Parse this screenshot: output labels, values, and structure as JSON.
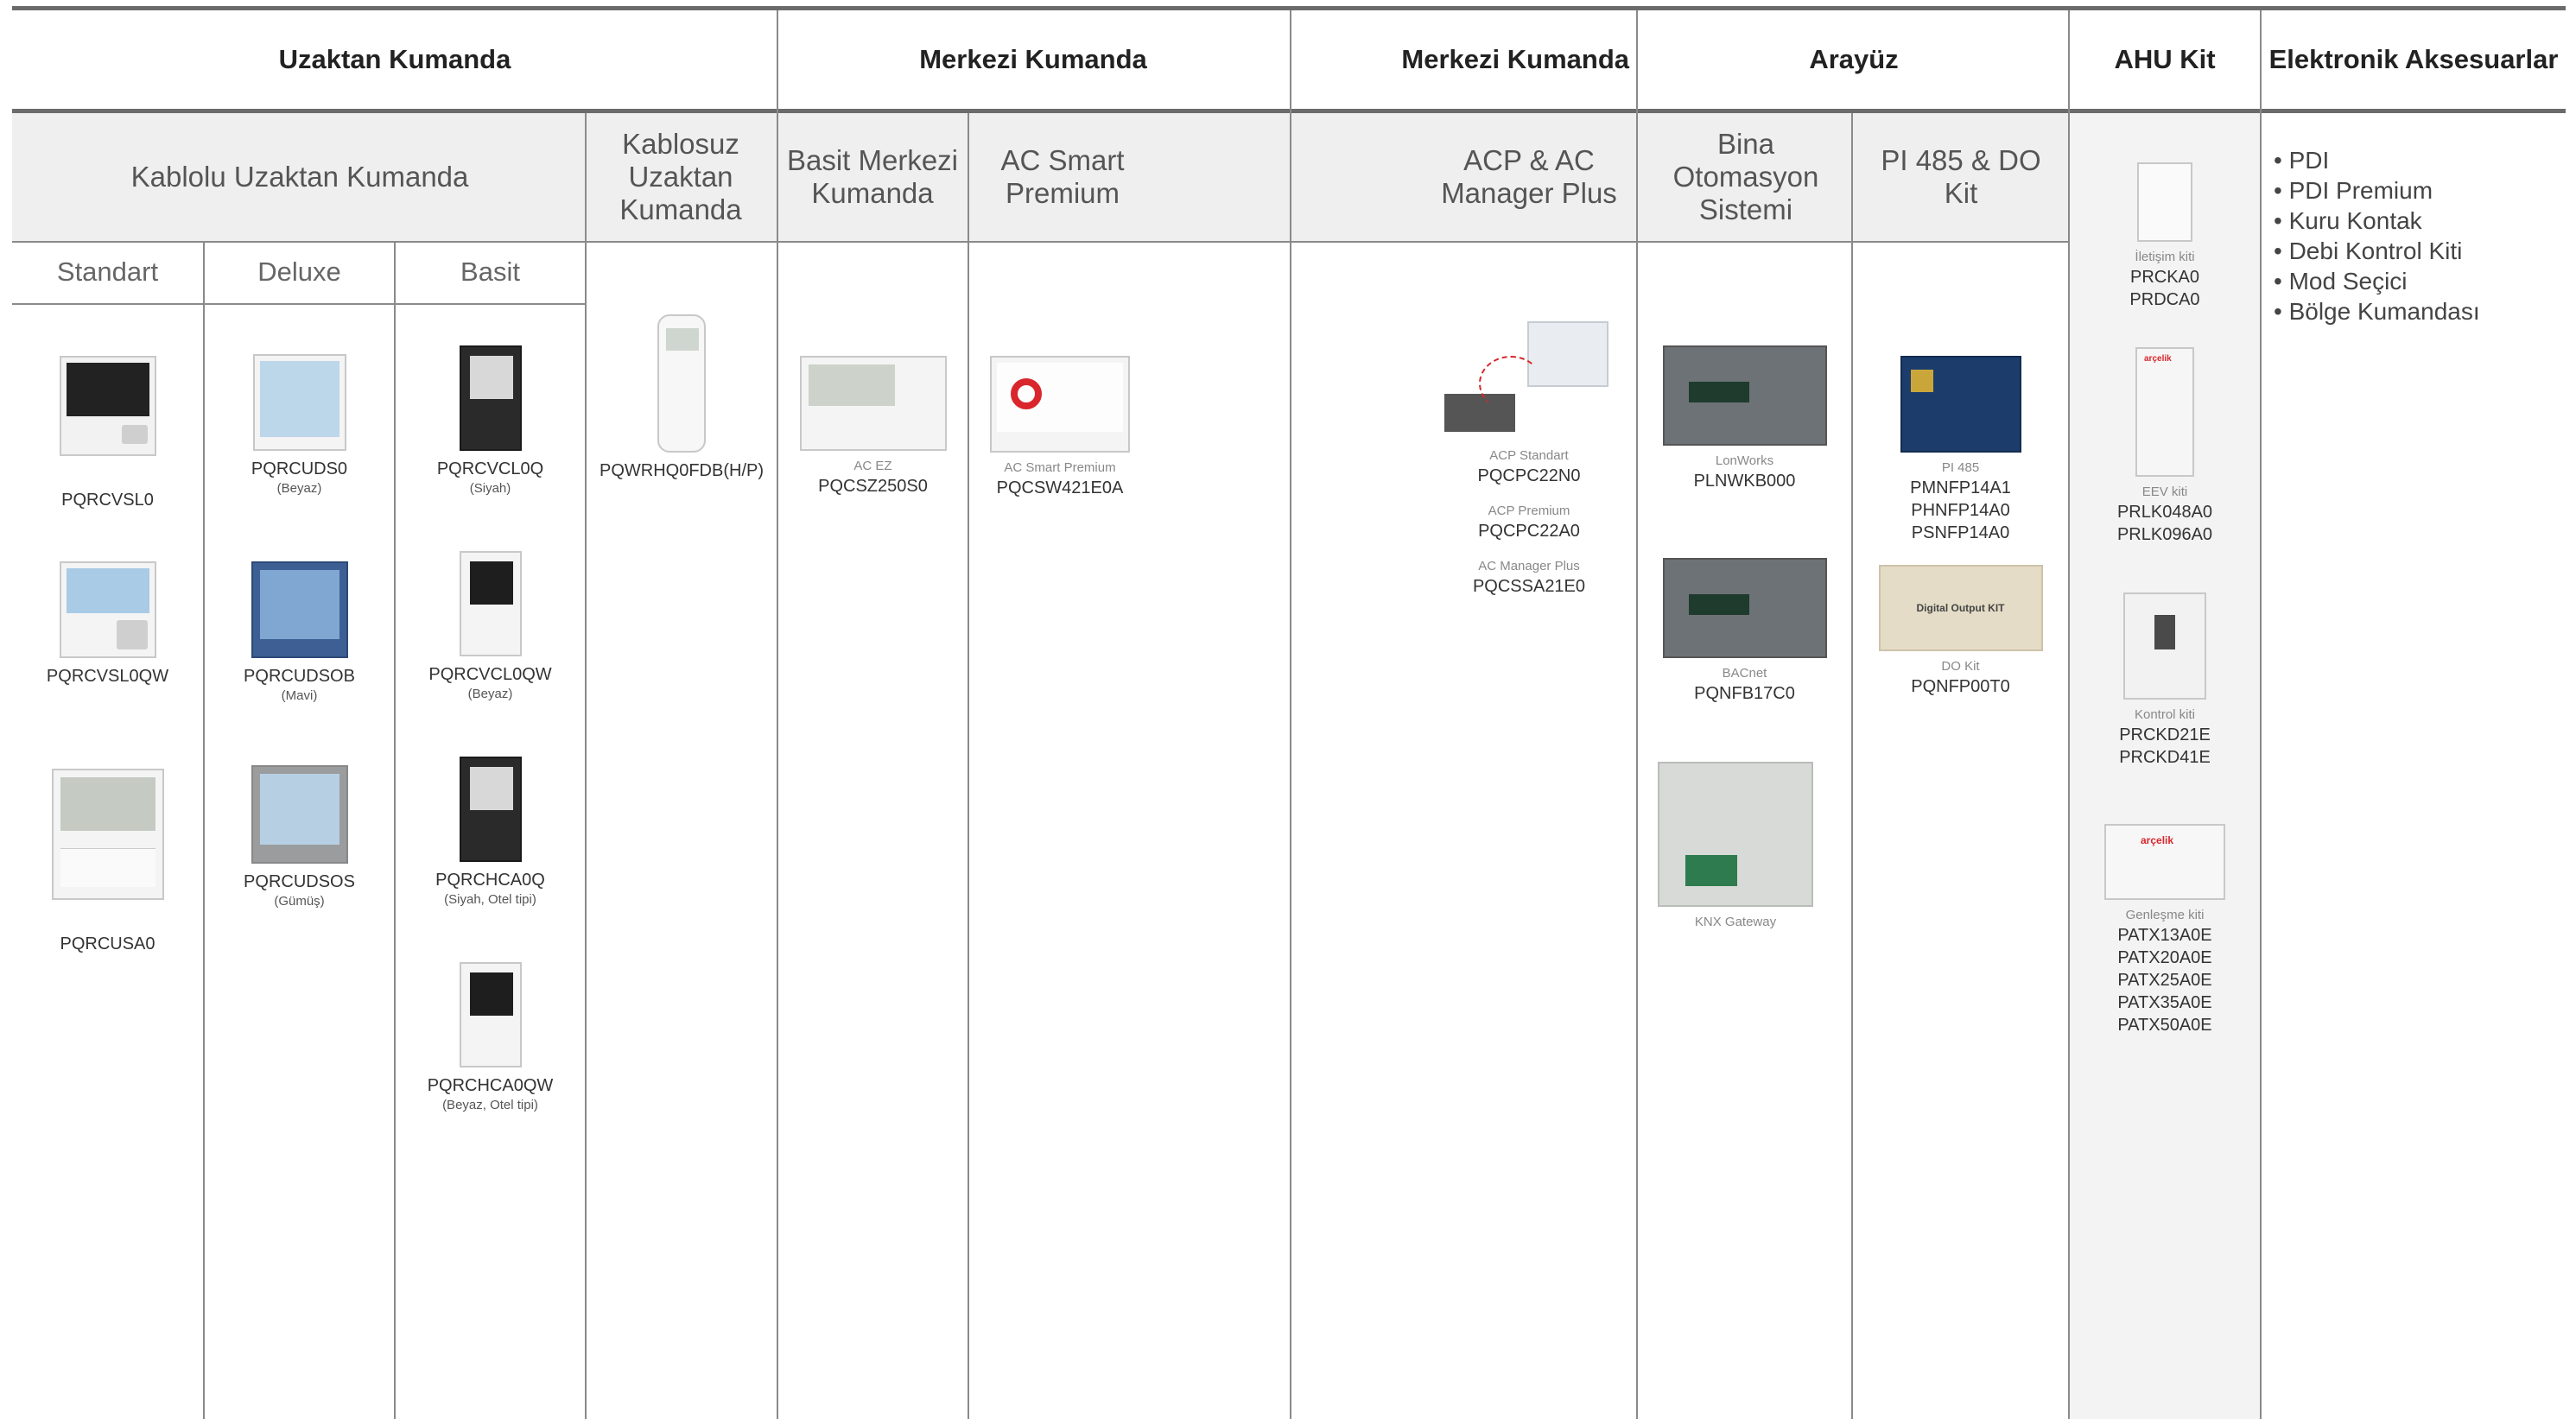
{
  "headers": {
    "uzaktan": "Uzaktan Kumanda",
    "merkezi1": "Merkezi Kumanda",
    "merkezi2": "Merkezi Kumanda",
    "arayuz": "Arayüz",
    "ahu": "AHU Kit",
    "elektronik": "Elektronik Aksesuarlar"
  },
  "subheaders": {
    "kablolu": "Kablolu Uzaktan Kumanda",
    "kablosuz": "Kablosuz Uzaktan Kumanda",
    "basit_merkezi": "Basit Merkezi Kumanda",
    "ac_smart": "AC Smart Premium",
    "acp": "ACP & AC Manager Plus",
    "bina": "Bina Otomasyon Sistemi",
    "pi485": "PI 485 & DO Kit"
  },
  "types": {
    "standart": "Standart",
    "deluxe": "Deluxe",
    "basit": "Basit"
  },
  "products": {
    "std1": "PQRCVSL0",
    "std2": "PQRCVSL0QW",
    "std3": "PQRCUSA0",
    "dlx1": "PQRCUDS0",
    "dlx1_note": "(Beyaz)",
    "dlx2": "PQRCUDSOB",
    "dlx2_note": "(Mavi)",
    "dlx3": "PQRCUDSOS",
    "dlx3_note": "(Gümüş)",
    "bas1": "PQRCVCL0Q",
    "bas1_note": "(Siyah)",
    "bas2": "PQRCVCL0QW",
    "bas2_note": "(Beyaz)",
    "bas3": "PQRCHCA0Q",
    "bas3_note": "(Siyah, Otel tipi)",
    "bas4": "PQRCHCA0QW",
    "bas4_note": "(Beyaz, Otel tipi)",
    "wireless": "PQWRHQ0FDB(H/P)",
    "acez_cap": "AC EZ",
    "acez": "PQCSZ250S0",
    "smart_cap": "AC Smart Premium",
    "smart": "PQCSW421E0A",
    "acp_std_cap": "ACP Standart",
    "acp_std": "PQCPC22N0",
    "acp_pre_cap": "ACP Premium",
    "acp_pre": "PQCPC22A0",
    "acm_cap": "AC Manager Plus",
    "acm": "PQCSSA21E0",
    "lon_cap": "LonWorks",
    "lon": "PLNWKB000",
    "bac_cap": "BACnet",
    "bac": "PQNFB17C0",
    "knx_cap": "KNX Gateway",
    "pi_cap": "PI 485",
    "pi1": "PMNFP14A1",
    "pi2": "PHNFP14A0",
    "pi3": "PSNFP14A0",
    "do_cap": "DO Kit",
    "do": "PQNFP00T0",
    "do_label": "Digital Output KIT",
    "ilet_cap": "İletişim kiti",
    "ilet1": "PRCKA0",
    "ilet2": "PRDCA0",
    "eev_cap": "EEV kiti",
    "eev1": "PRLK048A0",
    "eev2": "PRLK096A0",
    "kon_cap": "Kontrol kiti",
    "kon1": "PRCKD21E",
    "kon2": "PRCKD41E",
    "gen_cap": "Genleşme kiti",
    "gen1": "PATX13A0E",
    "gen2": "PATX20A0E",
    "gen3": "PATX25A0E",
    "gen4": "PATX35A0E",
    "gen5": "PATX50A0E"
  },
  "accessories": [
    "• PDI",
    "• PDI Premium",
    "• Kuru Kontak",
    "• Debi Kontrol Kiti",
    "• Mod Seçici",
    "• Bölge Kumandası"
  ],
  "brand": "arçelik",
  "colors": {
    "rule": "#6b6b6b",
    "band": "#efefef",
    "divider": "#8a8a8a",
    "brand_red": "#d9262c"
  }
}
